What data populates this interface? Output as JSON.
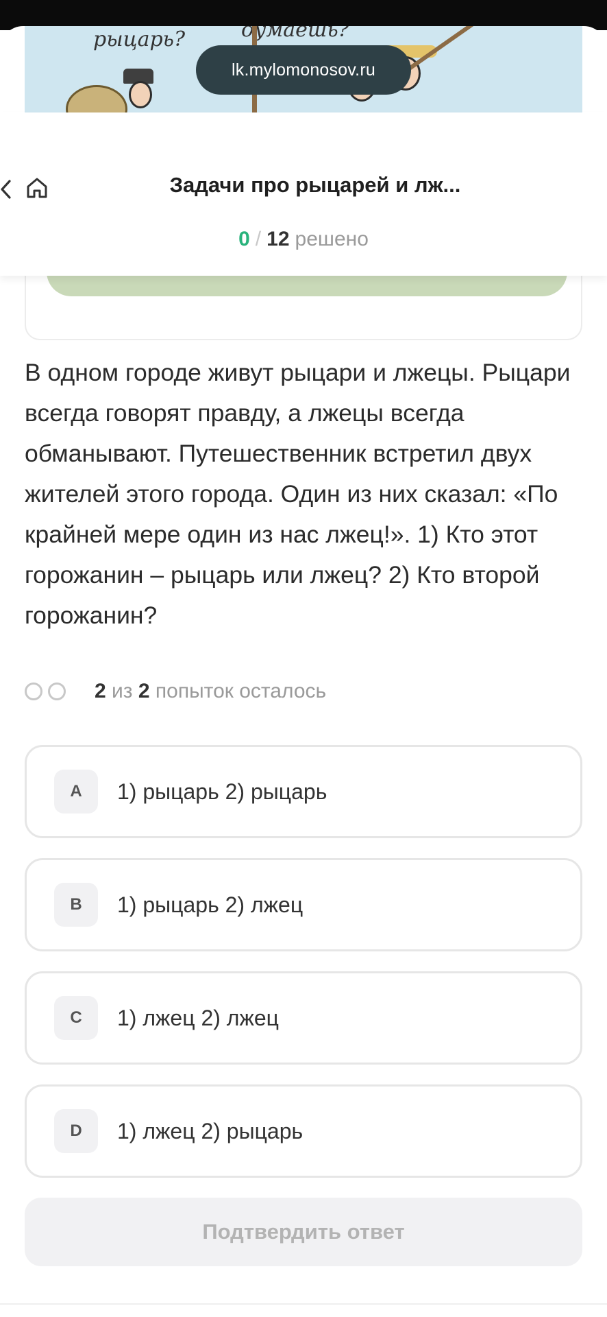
{
  "browser": {
    "url": "lk.mylomonosov.ru"
  },
  "illustration": {
    "caption_left": "рыцарь?",
    "caption_right": "думаешь?"
  },
  "header": {
    "title": "Задачи про рыцарей и лж...",
    "progress": {
      "solved": "0",
      "separator": "/",
      "total": "12",
      "label": "решено"
    }
  },
  "question": {
    "text": "В одном городе живут рыцари и лжецы. Рыцари всегда говорят правду, а лжецы всегда обманывают. Путешественник встретил двух жителей этого города. Один из них сказал: «По крайней мере один из нас лжец!». 1) Кто этот горожанин – рыцарь или лжец? 2) Кто второй горожанин?"
  },
  "attempts": {
    "left": "2",
    "of_word": "из",
    "total": "2",
    "label": "попыток осталось"
  },
  "options": [
    {
      "letter": "A",
      "text": "1) рыцарь 2) рыцарь"
    },
    {
      "letter": "B",
      "text": "1) рыцарь 2) лжец"
    },
    {
      "letter": "C",
      "text": "1) лжец 2) лжец"
    },
    {
      "letter": "D",
      "text": "1) лжец 2) рыцарь"
    }
  ],
  "confirm_label": "Подтвердить ответ",
  "colors": {
    "accent_green": "#29b37c",
    "url_pill": "#2e4046",
    "muted": "#9a9a9a"
  },
  "icons": {
    "back": "chevron-left-icon",
    "home": "home-icon"
  }
}
